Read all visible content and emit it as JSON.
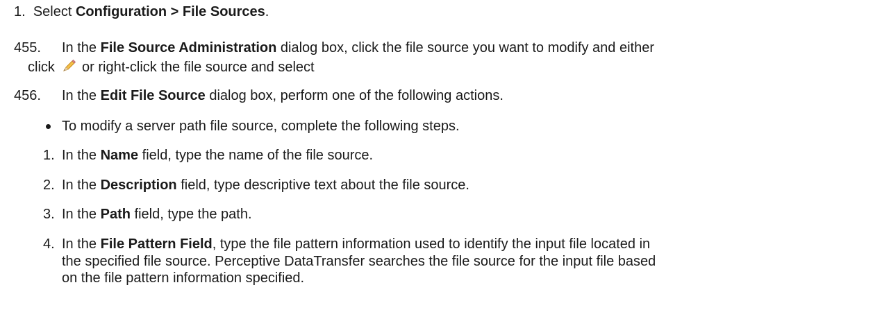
{
  "steps": {
    "s1": {
      "num": "1.",
      "pre": "Select ",
      "bold": "Configuration > File Sources",
      "post": "."
    },
    "s455": {
      "num": "455.",
      "pre": "In the ",
      "bold": "File Source Administration",
      "post": " dialog box, click the file source you want to modify and either",
      "cont_pre": "click ",
      "cont_post": " or right-click the file source and select",
      "icon": "pencil-edit-icon"
    },
    "s456": {
      "num": "456.",
      "pre": "In the ",
      "bold": "Edit File Source",
      "post": " dialog box, perform one of the following actions."
    }
  },
  "bullet": {
    "text": "To modify a server path file source, complete the following steps."
  },
  "substeps": [
    {
      "num": "1.",
      "pre": "In the ",
      "bold": "Name",
      "post": " field, type the name of the file source."
    },
    {
      "num": "2.",
      "pre": "In the ",
      "bold": "Description",
      "post": " field, type descriptive text about the file source."
    },
    {
      "num": "3.",
      "pre": "In the ",
      "bold": "Path",
      "post": " field, type the path."
    },
    {
      "num": "4.",
      "pre": "In the ",
      "bold": "File Pattern Field",
      "post": ", type the file pattern information used to identify the input file located  in",
      "cont1": "the specified file source. Perceptive DataTransfer searches the file source for the input file  based",
      "cont2": "on the file pattern information specified."
    }
  ]
}
